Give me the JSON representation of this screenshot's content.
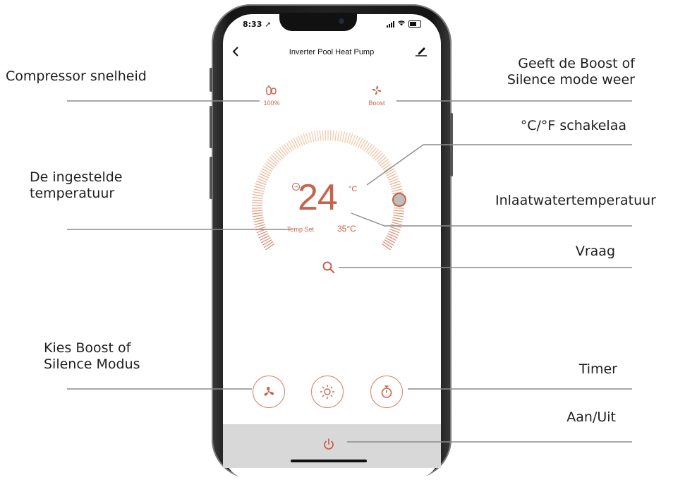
{
  "app": {
    "status_time": "8:33",
    "title": "Inverter Pool Heat Pump",
    "back_icon": "chevron-left-icon",
    "edit_icon": "pencil-icon"
  },
  "indicators": {
    "compressor": {
      "icon": "compressor-icon",
      "value": "100%"
    },
    "mode": {
      "icon": "fan-icon",
      "value": "Boost"
    }
  },
  "dial": {
    "temperature": "24",
    "unit": "°C",
    "temp_set_label": "Temp Set",
    "temp_set_value": "35°C"
  },
  "buttons": {
    "mode": "fan-icon",
    "sun": "sun-icon",
    "timer": "timer-icon",
    "power": "power-icon",
    "search": "search-icon"
  },
  "annotations": {
    "compressor_speed": "Compressor snelheid",
    "mode_display_line1": "Geeft de Boost of",
    "mode_display_line2": "Silence mode weer",
    "unit_switch": "°C/°F schakelaa",
    "set_temp_line1": "De ingestelde",
    "set_temp_line2": "temperatuur",
    "inlet_temp": "Inlaatwatertemperatuur",
    "question": "Vraag",
    "choose_mode_line1": "Kies Boost of",
    "choose_mode_line2": "Silence Modus",
    "timer": "Timer",
    "power": "Aan/Uit"
  },
  "colors": {
    "accent": "#c9624a",
    "dial_gradient_start": "#f3c9a4",
    "dial_gradient_end": "#d9826a"
  }
}
